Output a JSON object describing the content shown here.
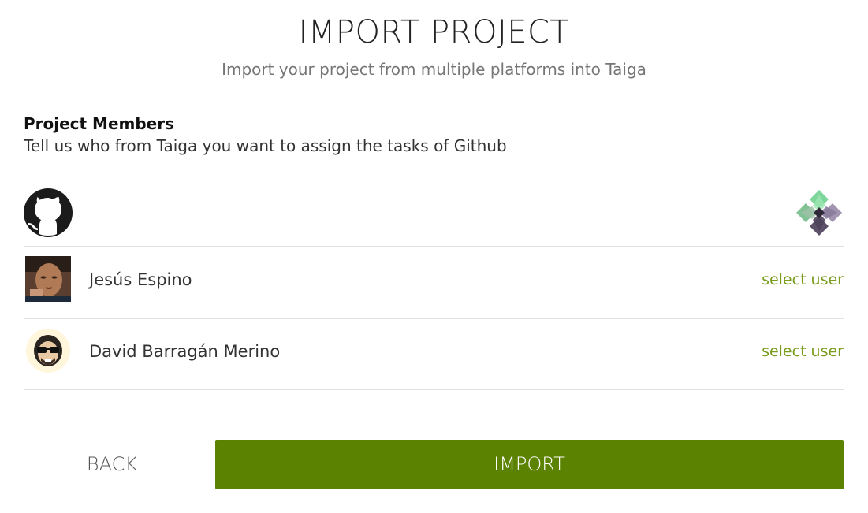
{
  "header": {
    "title": "IMPORT PROJECT",
    "subtitle": "Import your project from multiple platforms into Taiga"
  },
  "members_section": {
    "heading": "Project Members",
    "description": "Tell us who from Taiga you want to assign the tasks of Github",
    "source_platform_icon": "github-icon",
    "target_platform_icon": "taiga-icon",
    "members": [
      {
        "name": "Jesús Espino",
        "action_label": "select user",
        "avatar": "photo-avatar"
      },
      {
        "name": "David Barragán Merino",
        "action_label": "select user",
        "avatar": "cartoon-avatar"
      }
    ]
  },
  "actions": {
    "back_label": "BACK",
    "import_label": "IMPORT"
  },
  "colors": {
    "accent": "#5b8200",
    "link": "#7a9c1c",
    "divider": "#e0e0e0"
  }
}
